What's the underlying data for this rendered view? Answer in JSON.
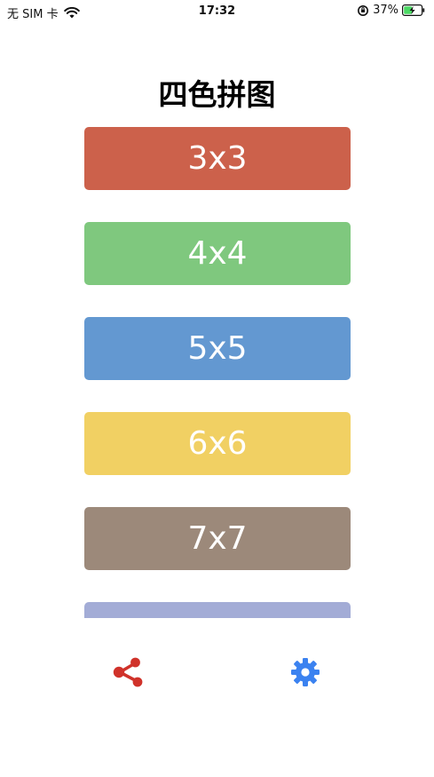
{
  "status_bar": {
    "carrier": "无 SIM 卡",
    "time": "17:32",
    "battery_percent": "37%",
    "icons": [
      "wifi-icon",
      "orientation-lock-icon",
      "battery-charging-icon"
    ]
  },
  "title": "四色拼图",
  "grid_options": [
    {
      "label": "3x3",
      "color": "#cc614b"
    },
    {
      "label": "4x4",
      "color": "#7fc87e"
    },
    {
      "label": "5x5",
      "color": "#6398d1"
    },
    {
      "label": "6x6",
      "color": "#f1d063"
    },
    {
      "label": "7x7",
      "color": "#9c897a"
    },
    {
      "label": "",
      "color": "#a3acd6"
    }
  ],
  "toolbar": {
    "share_icon": "share-icon",
    "share_color": "#d0322a",
    "settings_icon": "gear-icon",
    "settings_color": "#3b82f0"
  }
}
